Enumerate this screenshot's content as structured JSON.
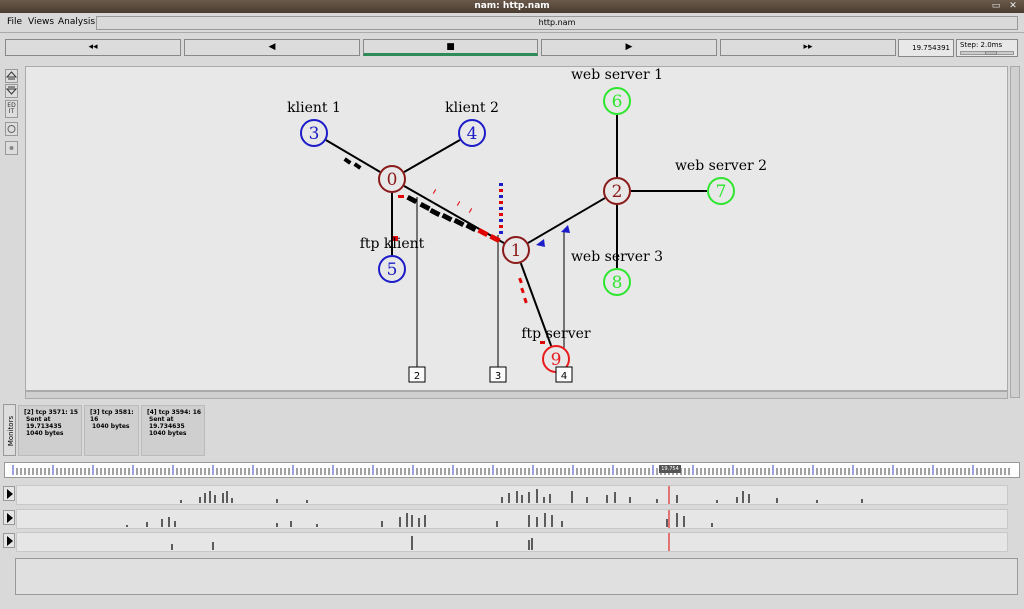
{
  "window": {
    "title": "nam: http.nam",
    "minimize": "▭",
    "close": "✕"
  },
  "menu": {
    "items": [
      "File",
      "Views",
      "Analysis"
    ],
    "file_name": "http.nam"
  },
  "playback": {
    "rewind_fast": "◂◂",
    "rewind": "◀",
    "stop": "■",
    "play": "▶",
    "forward_fast": "▸▸",
    "active": "stop"
  },
  "time": "19.754391",
  "step": {
    "label": "Step: 2.0ms"
  },
  "toolbar": {
    "icons": [
      "zoom-in-icon",
      "zoom-out-icon",
      "edit-icon",
      "node-circle-icon",
      "node-dot-icon"
    ],
    "edit_label": "ED IT"
  },
  "topology": {
    "nodes": [
      {
        "id": "0",
        "color": "#8b1a1a",
        "label": ""
      },
      {
        "id": "1",
        "color": "#8b1a1a",
        "label": ""
      },
      {
        "id": "2",
        "color": "#8b1a1a",
        "label": ""
      },
      {
        "id": "3",
        "color": "#1c1cc8",
        "label": "klient 1"
      },
      {
        "id": "4",
        "color": "#1c1cc8",
        "label": "klient 2"
      },
      {
        "id": "5",
        "color": "#1c1cc8",
        "label": "ftp klient"
      },
      {
        "id": "6",
        "color": "#2ee62e",
        "label": "web server 1"
      },
      {
        "id": "7",
        "color": "#2ee62e",
        "label": "web server 2"
      },
      {
        "id": "8",
        "color": "#2ee62e",
        "label": "web server 3"
      },
      {
        "id": "9",
        "color": "#e81c1c",
        "label": "ftp server"
      }
    ],
    "links": [
      [
        "3",
        "0"
      ],
      [
        "4",
        "0"
      ],
      [
        "0",
        "5"
      ],
      [
        "0",
        "1"
      ],
      [
        "1",
        "2"
      ],
      [
        "1",
        "9"
      ],
      [
        "2",
        "6"
      ],
      [
        "2",
        "7"
      ],
      [
        "2",
        "8"
      ]
    ],
    "monitor_tags": [
      "2",
      "3",
      "4"
    ]
  },
  "monitors": {
    "label": "Monitors",
    "items": [
      {
        "line1": "[2] tcp 3571: 15",
        "line2": "Sent at 19.713435",
        "line3": "1040 bytes"
      },
      {
        "line1": "[3] tcp 3581: 16",
        "line2": "1040 bytes",
        "line3": ""
      },
      {
        "line1": "[4] tcp 3594: 16",
        "line2": "Sent at 19.734635",
        "line3": "1040 bytes"
      }
    ]
  },
  "timeline": {
    "thumb_label": "19.754",
    "position": 0.645
  },
  "graphs": {
    "rows": 3,
    "cursor_color": "#e00000"
  }
}
